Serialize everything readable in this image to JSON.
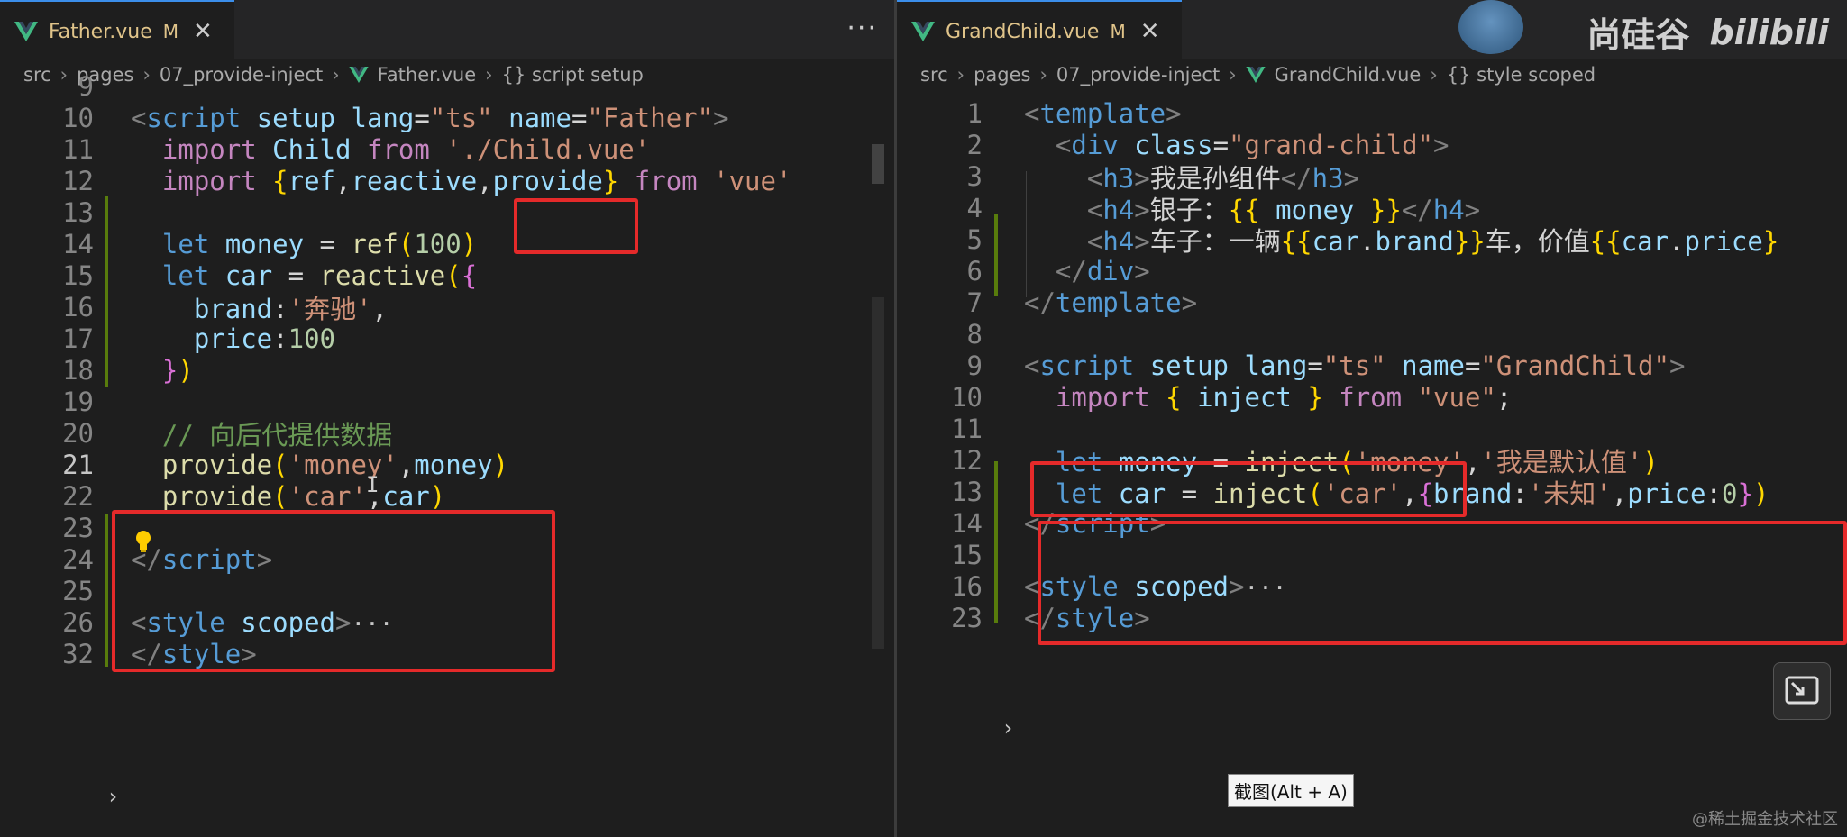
{
  "left": {
    "tab": {
      "title": "Father.vue",
      "modified": "M",
      "close": "✕"
    },
    "more": "···",
    "breadcrumb": [
      "src",
      "pages",
      "07_provide-inject",
      "Father.vue",
      "{} script setup"
    ],
    "lines": [
      {
        "n": "9",
        "tokens": []
      },
      {
        "n": "10",
        "tokens": [
          [
            "t-punc",
            "<"
          ],
          [
            "t-tag",
            "script"
          ],
          [
            "t-text",
            " "
          ],
          [
            "t-attr",
            "setup"
          ],
          [
            "t-text",
            " "
          ],
          [
            "t-attr",
            "lang"
          ],
          [
            "t-text",
            "="
          ],
          [
            "t-str",
            "\"ts\""
          ],
          [
            "t-text",
            " "
          ],
          [
            "t-attr",
            "name"
          ],
          [
            "t-text",
            "="
          ],
          [
            "t-str",
            "\"Father\""
          ],
          [
            "t-punc",
            ">"
          ]
        ]
      },
      {
        "n": "11",
        "tokens": [
          [
            "t-text",
            "  "
          ],
          [
            "t-kw",
            "import"
          ],
          [
            "t-text",
            " "
          ],
          [
            "t-var",
            "Child"
          ],
          [
            "t-text",
            " "
          ],
          [
            "t-kw",
            "from"
          ],
          [
            "t-text",
            " "
          ],
          [
            "t-str",
            "'./Child.vue'"
          ]
        ]
      },
      {
        "n": "12",
        "tokens": [
          [
            "t-text",
            "  "
          ],
          [
            "t-kw",
            "import"
          ],
          [
            "t-text",
            " "
          ],
          [
            "t-brace",
            "{"
          ],
          [
            "t-var",
            "ref"
          ],
          [
            "t-text",
            ","
          ],
          [
            "t-var",
            "reactive"
          ],
          [
            "t-text",
            ","
          ],
          [
            "t-var",
            "provide"
          ],
          [
            "t-brace",
            "}"
          ],
          [
            "t-text",
            " "
          ],
          [
            "t-kw",
            "from"
          ],
          [
            "t-text",
            " "
          ],
          [
            "t-str",
            "'vue'"
          ]
        ]
      },
      {
        "n": "13",
        "tokens": []
      },
      {
        "n": "14",
        "tokens": [
          [
            "t-text",
            "  "
          ],
          [
            "t-decl",
            "let"
          ],
          [
            "t-text",
            " "
          ],
          [
            "t-var",
            "money"
          ],
          [
            "t-text",
            " = "
          ],
          [
            "t-fn",
            "ref"
          ],
          [
            "t-brace",
            "("
          ],
          [
            "t-num",
            "100"
          ],
          [
            "t-brace",
            ")"
          ]
        ]
      },
      {
        "n": "15",
        "tokens": [
          [
            "t-text",
            "  "
          ],
          [
            "t-decl",
            "let"
          ],
          [
            "t-text",
            " "
          ],
          [
            "t-var",
            "car"
          ],
          [
            "t-text",
            " = "
          ],
          [
            "t-fn",
            "reactive"
          ],
          [
            "t-brace",
            "("
          ],
          [
            "t-brace2",
            "{"
          ]
        ]
      },
      {
        "n": "16",
        "tokens": [
          [
            "t-text",
            "    "
          ],
          [
            "t-var",
            "brand"
          ],
          [
            "t-text",
            ":"
          ],
          [
            "t-str",
            "'奔驰'"
          ],
          [
            "t-text",
            ","
          ]
        ]
      },
      {
        "n": "17",
        "tokens": [
          [
            "t-text",
            "    "
          ],
          [
            "t-var",
            "price"
          ],
          [
            "t-text",
            ":"
          ],
          [
            "t-num",
            "100"
          ]
        ]
      },
      {
        "n": "18",
        "tokens": [
          [
            "t-text",
            "  "
          ],
          [
            "t-brace2",
            "}"
          ],
          [
            "t-brace",
            ")"
          ]
        ]
      },
      {
        "n": "19",
        "tokens": []
      },
      {
        "n": "20",
        "tokens": [
          [
            "t-text",
            "  "
          ],
          [
            "t-com",
            "// 向后代提供数据"
          ]
        ]
      },
      {
        "n": "21",
        "tokens": [
          [
            "t-text",
            "  "
          ],
          [
            "t-fn",
            "provide"
          ],
          [
            "t-brace",
            "("
          ],
          [
            "t-str",
            "'money'"
          ],
          [
            "t-text",
            ","
          ],
          [
            "t-var",
            "money"
          ],
          [
            "t-brace",
            ")"
          ]
        ]
      },
      {
        "n": "22",
        "tokens": [
          [
            "t-text",
            "  "
          ],
          [
            "t-fn",
            "provide"
          ],
          [
            "t-brace",
            "("
          ],
          [
            "t-str",
            "'car'"
          ],
          [
            "t-text",
            ","
          ],
          [
            "t-var",
            "car"
          ],
          [
            "t-brace",
            ")"
          ]
        ]
      },
      {
        "n": "23",
        "tokens": []
      },
      {
        "n": "24",
        "tokens": [
          [
            "t-punc",
            "</"
          ],
          [
            "t-tag",
            "script"
          ],
          [
            "t-punc",
            ">"
          ]
        ]
      },
      {
        "n": "25",
        "tokens": []
      },
      {
        "n": "26",
        "tokens": [
          [
            "t-punc",
            "<"
          ],
          [
            "t-tag",
            "style"
          ],
          [
            "t-text",
            " "
          ],
          [
            "t-attr",
            "scoped"
          ],
          [
            "t-punc",
            ">"
          ],
          [
            "t-fold",
            "···"
          ]
        ]
      },
      {
        "n": "32",
        "tokens": [
          [
            "t-punc",
            "</"
          ],
          [
            "t-tag",
            "style"
          ],
          [
            "t-punc",
            ">"
          ]
        ]
      }
    ]
  },
  "right": {
    "tab": {
      "title": "GrandChild.vue",
      "modified": "M",
      "close": "✕"
    },
    "breadcrumb": [
      "src",
      "pages",
      "07_provide-inject",
      "GrandChild.vue",
      "{} style scoped"
    ],
    "lines": [
      {
        "n": "1",
        "tokens": [
          [
            "t-punc",
            "<"
          ],
          [
            "t-tag",
            "template"
          ],
          [
            "t-punc",
            ">"
          ]
        ]
      },
      {
        "n": "2",
        "tokens": [
          [
            "t-text",
            "  "
          ],
          [
            "t-punc",
            "<"
          ],
          [
            "t-tag",
            "div"
          ],
          [
            "t-text",
            " "
          ],
          [
            "t-attr",
            "class"
          ],
          [
            "t-text",
            "="
          ],
          [
            "t-str",
            "\"grand-child\""
          ],
          [
            "t-punc",
            ">"
          ]
        ]
      },
      {
        "n": "3",
        "tokens": [
          [
            "t-text",
            "    "
          ],
          [
            "t-punc",
            "<"
          ],
          [
            "t-tag",
            "h3"
          ],
          [
            "t-punc",
            ">"
          ],
          [
            "t-text",
            "我是孙组件"
          ],
          [
            "t-punc",
            "</"
          ],
          [
            "t-tag",
            "h3"
          ],
          [
            "t-punc",
            ">"
          ]
        ]
      },
      {
        "n": "4",
        "tokens": [
          [
            "t-text",
            "    "
          ],
          [
            "t-punc",
            "<"
          ],
          [
            "t-tag",
            "h4"
          ],
          [
            "t-punc",
            ">"
          ],
          [
            "t-text",
            "银子："
          ],
          [
            "t-brace",
            "{{"
          ],
          [
            "t-text",
            " "
          ],
          [
            "t-var",
            "money"
          ],
          [
            "t-text",
            " "
          ],
          [
            "t-brace",
            "}}"
          ],
          [
            "t-punc",
            "</"
          ],
          [
            "t-tag",
            "h4"
          ],
          [
            "t-punc",
            ">"
          ]
        ]
      },
      {
        "n": "5",
        "tokens": [
          [
            "t-text",
            "    "
          ],
          [
            "t-punc",
            "<"
          ],
          [
            "t-tag",
            "h4"
          ],
          [
            "t-punc",
            ">"
          ],
          [
            "t-text",
            "车子：一辆"
          ],
          [
            "t-brace",
            "{{"
          ],
          [
            "t-var",
            "car"
          ],
          [
            "t-text",
            "."
          ],
          [
            "t-var",
            "brand"
          ],
          [
            "t-brace",
            "}}"
          ],
          [
            "t-text",
            "车，价值"
          ],
          [
            "t-brace",
            "{{"
          ],
          [
            "t-var",
            "car"
          ],
          [
            "t-text",
            "."
          ],
          [
            "t-var",
            "price"
          ],
          [
            "t-brace",
            "}"
          ]
        ]
      },
      {
        "n": "6",
        "tokens": [
          [
            "t-text",
            "  "
          ],
          [
            "t-punc",
            "</"
          ],
          [
            "t-tag",
            "div"
          ],
          [
            "t-punc",
            ">"
          ]
        ]
      },
      {
        "n": "7",
        "tokens": [
          [
            "t-punc",
            "</"
          ],
          [
            "t-tag",
            "template"
          ],
          [
            "t-punc",
            ">"
          ]
        ]
      },
      {
        "n": "8",
        "tokens": []
      },
      {
        "n": "9",
        "tokens": [
          [
            "t-punc",
            "<"
          ],
          [
            "t-tag",
            "script"
          ],
          [
            "t-text",
            " "
          ],
          [
            "t-attr",
            "setup"
          ],
          [
            "t-text",
            " "
          ],
          [
            "t-attr",
            "lang"
          ],
          [
            "t-text",
            "="
          ],
          [
            "t-str",
            "\"ts\""
          ],
          [
            "t-text",
            " "
          ],
          [
            "t-attr",
            "name"
          ],
          [
            "t-text",
            "="
          ],
          [
            "t-str",
            "\"GrandChild\""
          ],
          [
            "t-punc",
            ">"
          ]
        ]
      },
      {
        "n": "10",
        "tokens": [
          [
            "t-text",
            "  "
          ],
          [
            "t-kw",
            "import"
          ],
          [
            "t-text",
            " "
          ],
          [
            "t-brace",
            "{"
          ],
          [
            "t-text",
            " "
          ],
          [
            "t-var",
            "inject"
          ],
          [
            "t-text",
            " "
          ],
          [
            "t-brace",
            "}"
          ],
          [
            "t-text",
            " "
          ],
          [
            "t-kw",
            "from"
          ],
          [
            "t-text",
            " "
          ],
          [
            "t-str",
            "\"vue\""
          ],
          [
            "t-text",
            ";"
          ]
        ]
      },
      {
        "n": "11",
        "tokens": []
      },
      {
        "n": "12",
        "tokens": [
          [
            "t-text",
            "  "
          ],
          [
            "t-decl",
            "let"
          ],
          [
            "t-text",
            " "
          ],
          [
            "t-var",
            "money"
          ],
          [
            "t-text",
            " = "
          ],
          [
            "t-fn",
            "inject"
          ],
          [
            "t-brace",
            "("
          ],
          [
            "t-str",
            "'money'"
          ],
          [
            "t-text",
            ","
          ],
          [
            "t-str",
            "'我是默认值'"
          ],
          [
            "t-brace",
            ")"
          ]
        ]
      },
      {
        "n": "13",
        "tokens": [
          [
            "t-text",
            "  "
          ],
          [
            "t-decl",
            "let"
          ],
          [
            "t-text",
            " "
          ],
          [
            "t-var",
            "car"
          ],
          [
            "t-text",
            " = "
          ],
          [
            "t-fn",
            "inject"
          ],
          [
            "t-brace",
            "("
          ],
          [
            "t-str",
            "'car'"
          ],
          [
            "t-text",
            ","
          ],
          [
            "t-brace2",
            "{"
          ],
          [
            "t-var",
            "brand"
          ],
          [
            "t-text",
            ":"
          ],
          [
            "t-str",
            "'未知'"
          ],
          [
            "t-text",
            ","
          ],
          [
            "t-var",
            "price"
          ],
          [
            "t-text",
            ":"
          ],
          [
            "t-num",
            "0"
          ],
          [
            "t-brace2",
            "}"
          ],
          [
            "t-brace",
            ")"
          ]
        ]
      },
      {
        "n": "14",
        "tokens": [
          [
            "t-punc",
            "</"
          ],
          [
            "t-tag",
            "script"
          ],
          [
            "t-punc",
            ">"
          ]
        ]
      },
      {
        "n": "15",
        "tokens": []
      },
      {
        "n": "16",
        "tokens": [
          [
            "t-punc",
            "<"
          ],
          [
            "t-tag",
            "style"
          ],
          [
            "t-text",
            " "
          ],
          [
            "t-attr",
            "scoped"
          ],
          [
            "t-punc",
            ">"
          ],
          [
            "t-fold",
            "···"
          ]
        ]
      },
      {
        "n": "23",
        "tokens": [
          [
            "t-punc",
            "</"
          ],
          [
            "t-tag",
            "style"
          ],
          [
            "t-punc",
            ">"
          ]
        ]
      }
    ]
  },
  "tooltip": "截图(Alt + A)",
  "watermark": {
    "brand": "尚硅谷",
    "logo": "bilibili",
    "corner": "@稀土掘金技术社区"
  },
  "icons": {
    "vue": "vue-logo-icon",
    "bulb": "lightbulb-icon",
    "fold": "chevron-right-icon",
    "float": "picture-in-picture-icon"
  }
}
